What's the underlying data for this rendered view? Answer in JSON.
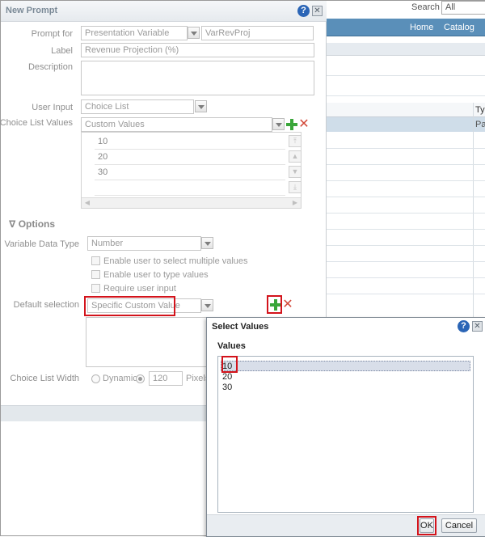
{
  "background_app": {
    "search_label": "Search",
    "search_value": "All",
    "nav": [
      "Home",
      "Catalog"
    ],
    "column_header": "Ty",
    "column_cell": "Pa"
  },
  "prompt_dialog": {
    "title": "New Prompt",
    "prompt_for": {
      "label": "Prompt for",
      "value": "Presentation Variable",
      "variable": "VarRevProj"
    },
    "label_field": {
      "label": "Label",
      "value": "Revenue Projection (%)"
    },
    "description": {
      "label": "Description",
      "value": ""
    },
    "user_input": {
      "label": "User Input",
      "value": "Choice List"
    },
    "choice_list_values": {
      "label": "Choice List Values",
      "value": "Custom Values",
      "items": [
        "10",
        "20",
        "30"
      ]
    },
    "options": {
      "heading": "Options",
      "variable_data_type": {
        "label": "Variable Data Type",
        "value": "Number"
      },
      "checkboxes": [
        "Enable user to select multiple values",
        "Enable user to type values",
        "Require user input"
      ],
      "default_selection": {
        "label": "Default selection",
        "value": "Specific Custom Value"
      },
      "choice_list_width": {
        "label": "Choice List Width",
        "dynamic_label": "Dynamic",
        "width_value": "120",
        "unit": "Pixels"
      }
    }
  },
  "select_values_dialog": {
    "title": "Select Values",
    "values_label": "Values",
    "items": [
      "10",
      "20",
      "30"
    ],
    "selected_index": 0,
    "ok_label": "OK",
    "cancel_label": "Cancel"
  },
  "icons": {
    "help": "help-icon",
    "close": "close-icon",
    "add": "plus-icon",
    "delete": "delete-icon"
  },
  "colors": {
    "nav_bar": "#5a8fb9",
    "highlight_box": "#d3131b",
    "add_icon": "#3aa63a",
    "delete_icon": "#d34a3a"
  },
  "glyphs": {
    "help": "?",
    "close": "✕",
    "delete": "✕",
    "collapse": "∇",
    "scroll_left": "◀",
    "scroll_right": "▶",
    "move_top": "⤒",
    "move_up": "▲",
    "move_down": "▼",
    "move_bottom": "⤓"
  }
}
